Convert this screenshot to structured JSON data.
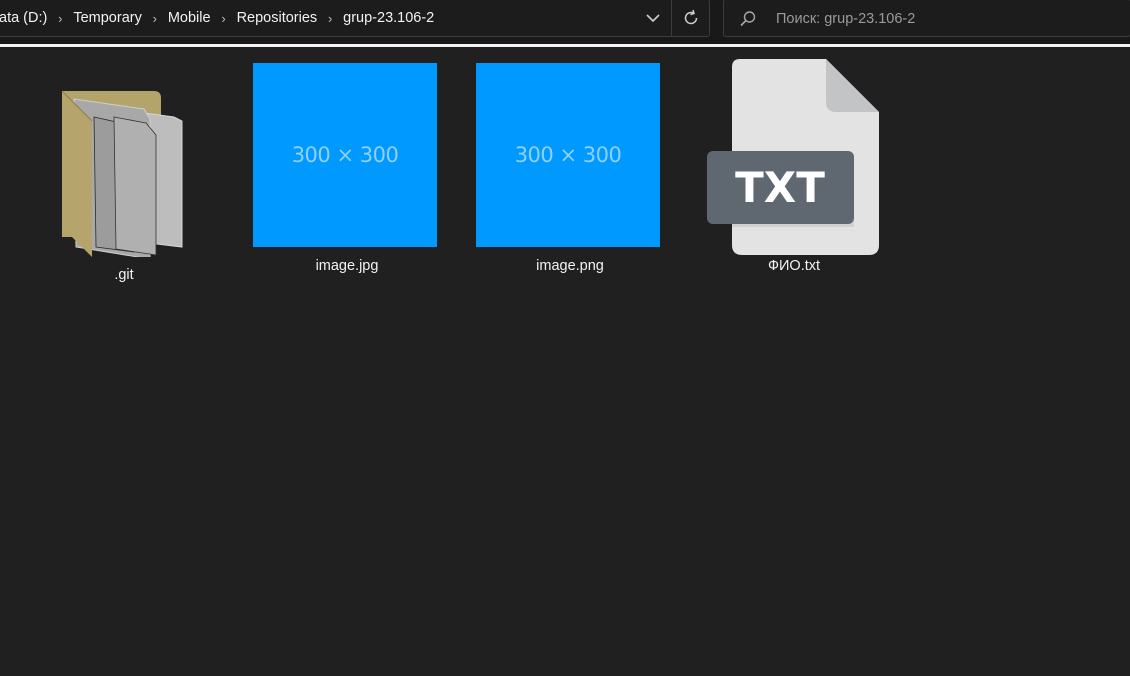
{
  "address_bar": {
    "breadcrumbs": [
      {
        "label": "ata (D:)"
      },
      {
        "label": "Temporary"
      },
      {
        "label": "Mobile"
      },
      {
        "label": "Repositories"
      },
      {
        "label": "grup-23.106-2"
      }
    ],
    "separator_icon": "chevron-right-icon",
    "dropdown_icon": "chevron-down-icon",
    "refresh_icon": "refresh-icon"
  },
  "search": {
    "placeholder": "Поиск: grup-23.106-2",
    "value": "",
    "icon": "search-icon"
  },
  "files": [
    {
      "name": ".git",
      "type": "folder",
      "icon": "folder-icon"
    },
    {
      "name": "image.jpg",
      "type": "image",
      "thumbnail_text": "300 × 300",
      "thumbnail_color": "#0099ff"
    },
    {
      "name": "image.png",
      "type": "image",
      "thumbnail_text": "300 × 300",
      "thumbnail_color": "#0099ff"
    },
    {
      "name": "ФИО.txt",
      "type": "text",
      "icon": "txt-file-icon",
      "badge": "TXT"
    }
  ],
  "colors": {
    "background": "#202020",
    "toolbar": "#191919",
    "thumbnail_blue": "#0099ff",
    "txt_badge": "#5f6770",
    "folder": "#b3a46a"
  }
}
